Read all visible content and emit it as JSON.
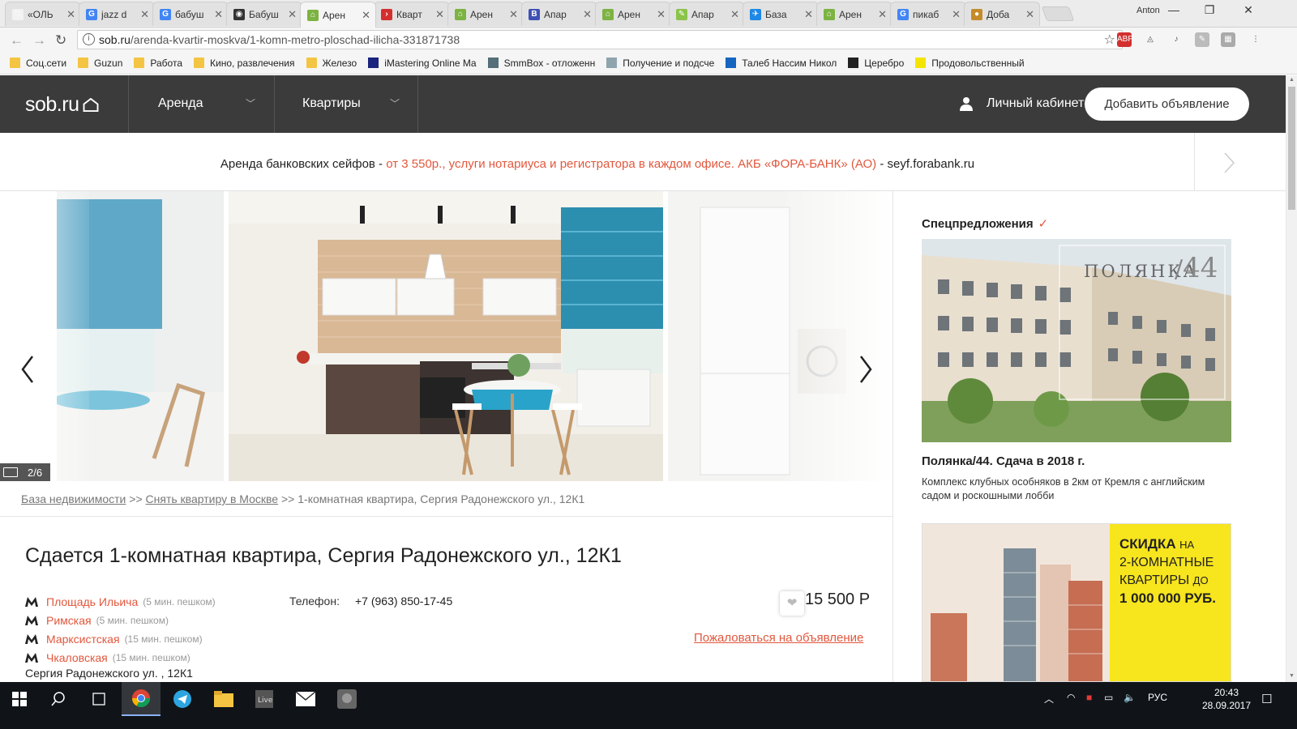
{
  "browser": {
    "tabs": [
      {
        "label": "«ОЛЬ",
        "color": "#f2f2f2",
        "glyph": "□",
        "active": false
      },
      {
        "label": "jazz d",
        "color": "#4285f4",
        "glyph": "G",
        "active": false
      },
      {
        "label": "бабуш",
        "color": "#4285f4",
        "glyph": "G",
        "active": false
      },
      {
        "label": "Бабуш",
        "color": "#333333",
        "glyph": "◉",
        "active": false
      },
      {
        "label": "Арен",
        "color": "#7cb342",
        "glyph": "⌂",
        "active": true
      },
      {
        "label": "Кварт",
        "color": "#d32f2f",
        "glyph": "›",
        "active": false
      },
      {
        "label": "Арен",
        "color": "#7cb342",
        "glyph": "⌂",
        "active": false
      },
      {
        "label": "Апар",
        "color": "#3f51b5",
        "glyph": "B",
        "active": false
      },
      {
        "label": "Арен",
        "color": "#7cb342",
        "glyph": "⌂",
        "active": false
      },
      {
        "label": "Апар",
        "color": "#8bc34a",
        "glyph": "✎",
        "active": false
      },
      {
        "label": "База",
        "color": "#1e88e5",
        "glyph": "✈",
        "active": false
      },
      {
        "label": "Арен",
        "color": "#7cb342",
        "glyph": "⌂",
        "active": false
      },
      {
        "label": "пикаб",
        "color": "#4285f4",
        "glyph": "G",
        "active": false
      },
      {
        "label": "Доба",
        "color": "#c58b2a",
        "glyph": "●",
        "active": false
      }
    ],
    "window_user": "Anton",
    "url_domain": "sob.ru",
    "url_path": "/arenda-kvartir-moskva/1-komn-metro-ploschad-ilicha-331871738",
    "bookmarks": [
      {
        "label": "Соц.сети",
        "type": "folder"
      },
      {
        "label": "Guzun",
        "type": "folder"
      },
      {
        "label": "Работа",
        "type": "folder"
      },
      {
        "label": "Кино, развлечения",
        "type": "folder"
      },
      {
        "label": "Железо",
        "type": "folder"
      },
      {
        "label": "iMastering Online Ma",
        "type": "site"
      },
      {
        "label": "SmmBox - отложенн",
        "type": "site"
      },
      {
        "label": "Получение и подсче",
        "type": "site"
      },
      {
        "label": "Талеб Нассим Никол",
        "type": "site"
      },
      {
        "label": "Церебро",
        "type": "site"
      },
      {
        "label": "Продовольственный",
        "type": "site"
      }
    ]
  },
  "site": {
    "logo": "sob.ru",
    "menu": [
      "Аренда",
      "Квартиры"
    ],
    "cabinet": "Личный кабинет",
    "add_button": "Добавить объявление"
  },
  "ad_banner": {
    "lead": "Аренда банковских сейфов - ",
    "offer": "от 3 550р., услуги нотариуса и регистратора в каждом офисе. АКБ «ФОРА-БАНК» (АО)",
    "tail": " - seyf.forabank.ru"
  },
  "gallery": {
    "counter": "2/6"
  },
  "breadcrumb": {
    "items": [
      "База недвижимости",
      "Снять квартиру в Москве"
    ],
    "separator": ">>",
    "current": "1-комнатная квартира, Сергия Радонежского ул., 12К1"
  },
  "listing": {
    "title": "Сдается 1-комнатная квартира, Сергия Радонежского ул., 12К1",
    "metro": [
      {
        "name": "Площадь Ильича",
        "time": "(5 мин. пешком)"
      },
      {
        "name": "Римская",
        "time": "(5 мин. пешком)"
      },
      {
        "name": "Марксистская",
        "time": "(15 мин. пешком)"
      },
      {
        "name": "Чкаловская",
        "time": "(15 мин. пешком)"
      }
    ],
    "address": "Сергия Радонежского ул.  , 12К1",
    "phone_label": "Телефон:",
    "phone": "+7 (963) 850-17-45",
    "price": "15 500 Р",
    "complain": "Пожаловаться на объявление"
  },
  "sidebar": {
    "title": "Спецпредложения",
    "ad1_brand": "ПОЛЯНКА",
    "ad1_number": "44",
    "ad1_title": "Полянка/44. Сдача в 2018 г.",
    "ad1_desc": "Комплекс клубных особняков в 2км от Кремля с английским садом и роскошными лобби",
    "ad2_line1": "СКИДКА",
    "ad2_line1b": "НА",
    "ad2_line2": "2-КОМНАТНЫЕ",
    "ad2_line3": "КВАРТИРЫ",
    "ad2_line3b": "ДО",
    "ad2_line4": "1 000 000 РУБ."
  },
  "taskbar": {
    "lang": "РУС",
    "time": "20:43",
    "date": "28.09.2017"
  },
  "colors": {
    "accent": "#e2573c",
    "header": "#3b3b3b",
    "ad_yellow": "#f7e51d"
  }
}
